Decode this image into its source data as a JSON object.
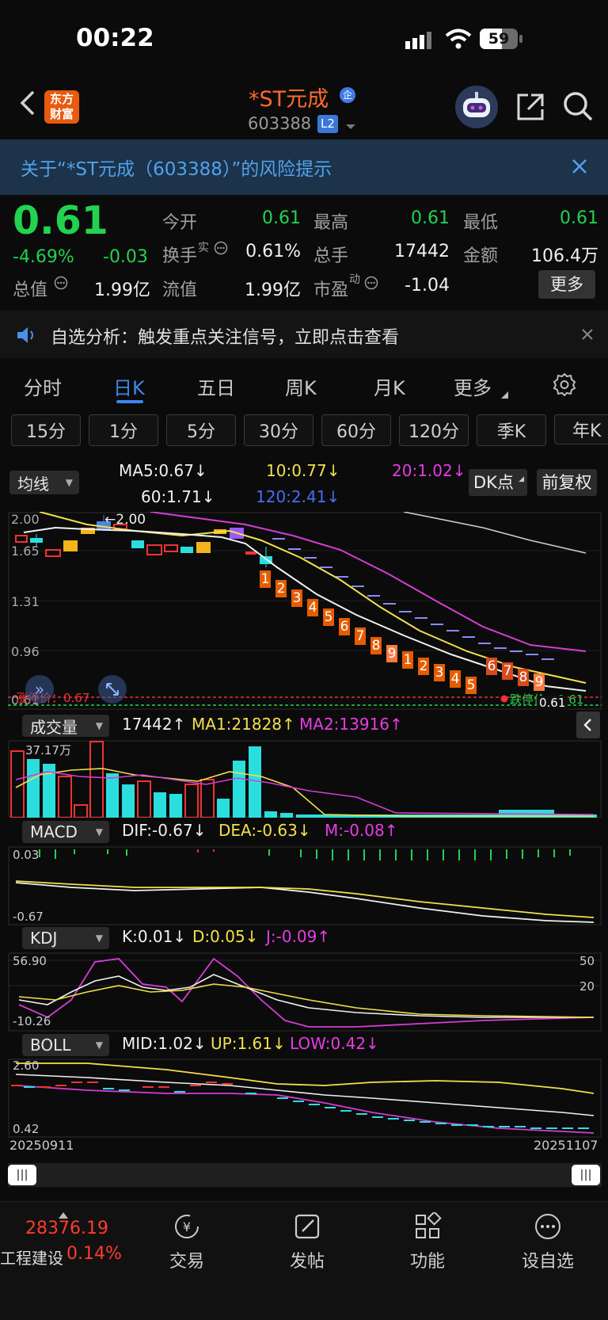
{
  "status_bar": {
    "time": "00:22",
    "battery": "59"
  },
  "header": {
    "logo_line1": "东方",
    "logo_line2": "财富",
    "stock_name": "*ST元成",
    "badge": "企",
    "code": "603388",
    "level": "L2"
  },
  "risk_banner": {
    "text": "关于“*ST元成（603388）”的风险提示"
  },
  "quote": {
    "price": "0.61",
    "change_pct": "-4.69%",
    "change": "-0.03",
    "rows": [
      [
        {
          "label": "今开",
          "value": "0.61",
          "color": "green"
        },
        {
          "label": "最高",
          "value": "0.61",
          "color": "green"
        },
        {
          "label": "最低",
          "value": "0.61",
          "color": "green"
        }
      ],
      [
        {
          "label": "换手",
          "value": "0.61%",
          "color": "white"
        },
        {
          "label": "总手",
          "value": "17442",
          "color": "white"
        },
        {
          "label": "金额",
          "value": "106.4万",
          "color": "white"
        }
      ],
      [
        {
          "label": "总值",
          "value": "1.99亿",
          "color": "white"
        },
        {
          "label": "流值",
          "value": "1.99亿",
          "color": "white"
        },
        {
          "label": "市盈",
          "value": "-1.04",
          "color": "white"
        }
      ]
    ],
    "turnover_sup": "实",
    "pe_sup": "动",
    "more": "更多"
  },
  "notice": {
    "text": "自选分析：触发重点关注信号，立即点击查看"
  },
  "chart_tabs": [
    "分时",
    "日K",
    "五日",
    "周K",
    "月K",
    "更多"
  ],
  "active_tab": "日K",
  "period_pills": [
    "15分",
    "1分",
    "5分",
    "30分",
    "60分",
    "120分",
    "季K",
    "年K"
  ],
  "ma_bar": {
    "selector": "均线",
    "ma5": "MA5:0.67",
    "ma10": "10:0.77",
    "ma20": "20:1.02",
    "ma60": "60:1.71",
    "ma120": "120:2.41",
    "dk": "DK点",
    "adjust": "前复权"
  },
  "kline": {
    "y_labels": [
      "2.00",
      "1.65",
      "1.31",
      "0.96",
      "0.61"
    ],
    "high_mark": "2.00",
    "limit_up": "涨停价：0.67",
    "limit_down": "跌停价：0.61",
    "last_price": "0.61",
    "seq_first": [
      "1",
      "2",
      "3",
      "4",
      "5",
      "6",
      "7",
      "8",
      "9"
    ],
    "seq_second": [
      "1",
      "2",
      "3",
      "4",
      "5",
      "6",
      "7",
      "8",
      "9"
    ]
  },
  "volume": {
    "selector": "成交量",
    "value": "17442",
    "ma1": "MA1:21828",
    "ma2": "MA2:13916",
    "max": "37.17万"
  },
  "macd": {
    "selector": "MACD",
    "dif": "DIF:-0.67",
    "dea": "DEA:-0.63",
    "m": "M:-0.08",
    "top": "0.03",
    "bottom": "-0.67"
  },
  "kdj": {
    "selector": "KDJ",
    "k": "K:0.01",
    "d": "D:0.05",
    "j": "J:-0.09",
    "top": "56.90",
    "bottom": "-10.26",
    "r50": "50",
    "r20": "20"
  },
  "boll": {
    "selector": "BOLL",
    "mid": "MID:1.02",
    "up": "UP:1.61",
    "low": "LOW:0.42",
    "top": "2.60",
    "bottom": "0.42"
  },
  "dates": {
    "start": "20250911",
    "end": "20251107"
  },
  "bottom_nav": {
    "index_value": "28376.19",
    "index_name": "工程建设",
    "index_change": "0.14%",
    "items": [
      "交易",
      "发帖",
      "功能",
      "设自选"
    ]
  }
}
